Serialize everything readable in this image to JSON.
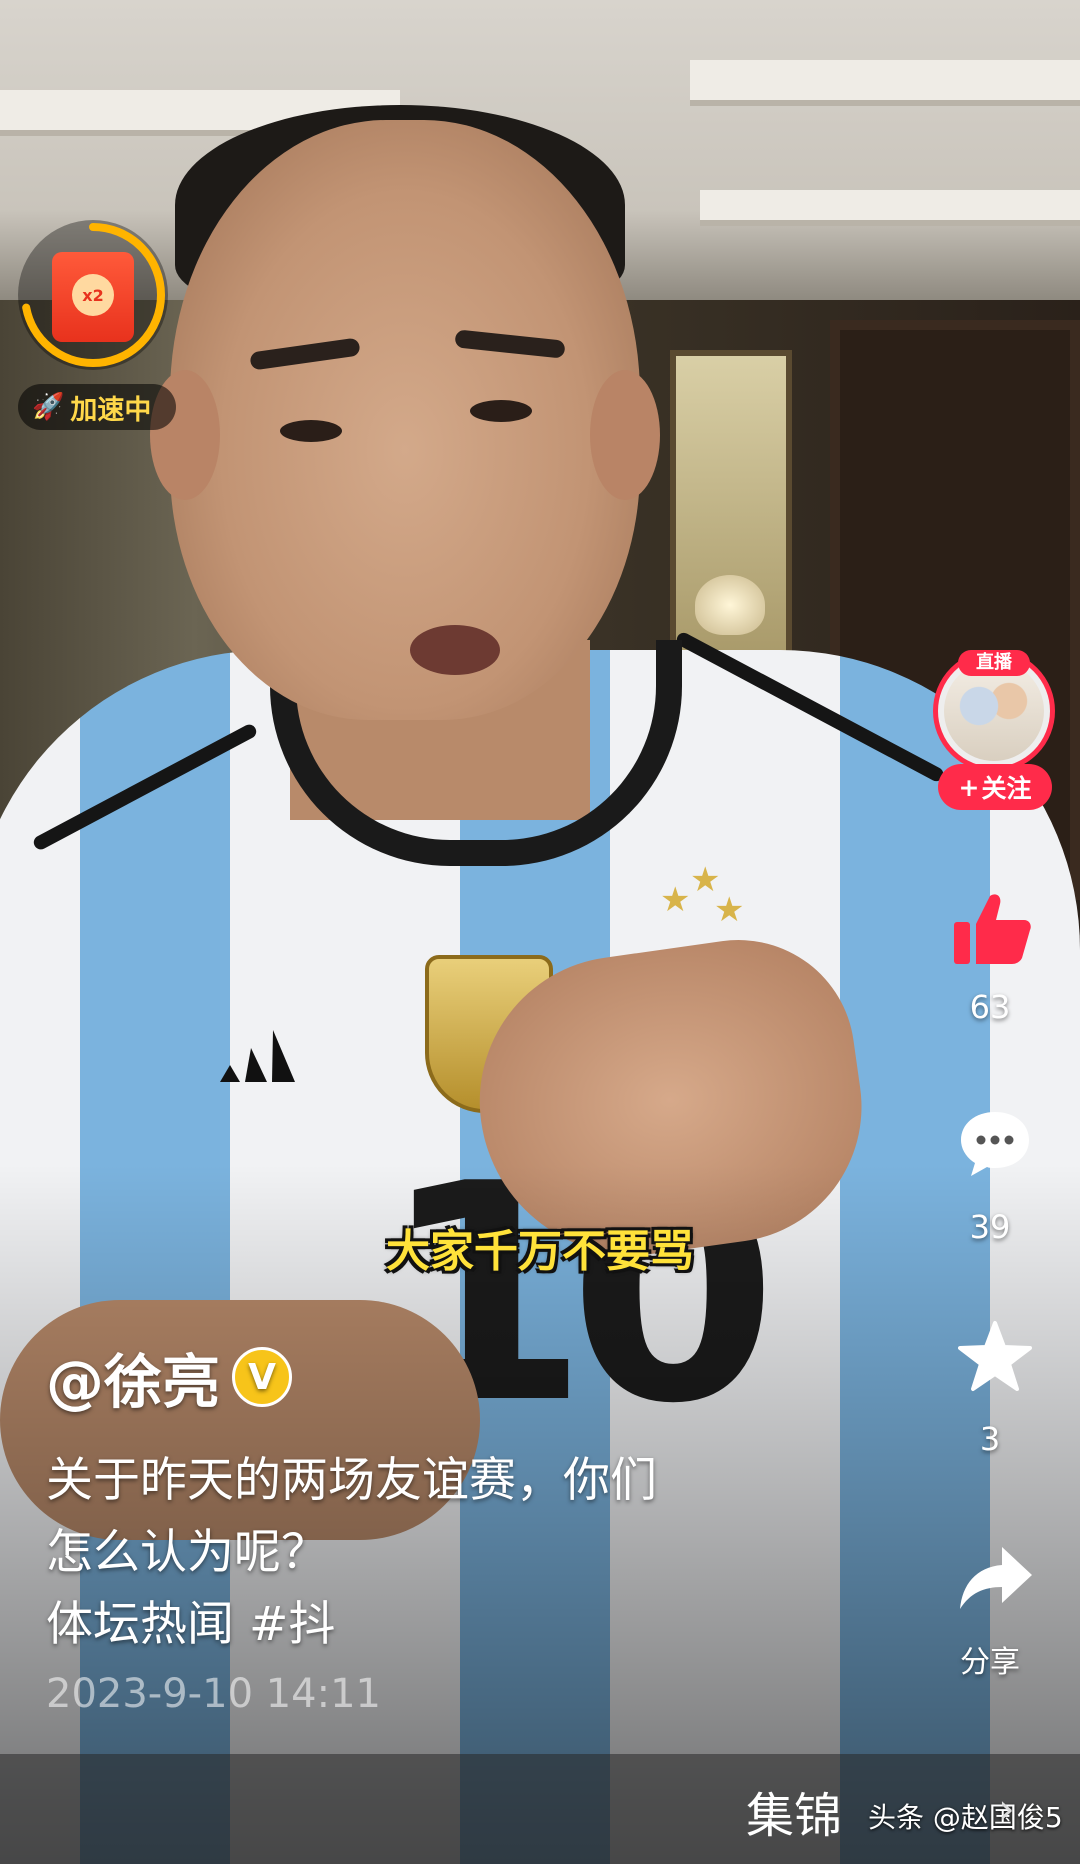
{
  "speed_widget": {
    "coin_label": "x2",
    "status_label": "加速中",
    "progress": 0.72,
    "ring_color": "#ffb400"
  },
  "subtitle": "大家千万不要骂",
  "right_rail": {
    "live_tag": "直播",
    "follow_label": "关注",
    "like_count": "63",
    "comment_count": "39",
    "favorite_count": "3",
    "share_label": "分享",
    "like_color": "#ff2b4a"
  },
  "caption": {
    "author": "@徐亮",
    "verified_mark": "V",
    "description_line1": "关于昨天的两场友谊赛，你们",
    "description_line2": "怎么认为呢？",
    "description_line3": "体坛热闻 #抖",
    "date": "2023-9-10 14:11"
  },
  "bottom_bar": {
    "collection_label": "集锦",
    "watermark": "头条 @赵国俊5"
  },
  "icons": [
    "rocket-icon",
    "red-packet-icon",
    "like-icon",
    "comment-icon",
    "favorite-icon",
    "share-icon",
    "chevron-right-icon"
  ]
}
